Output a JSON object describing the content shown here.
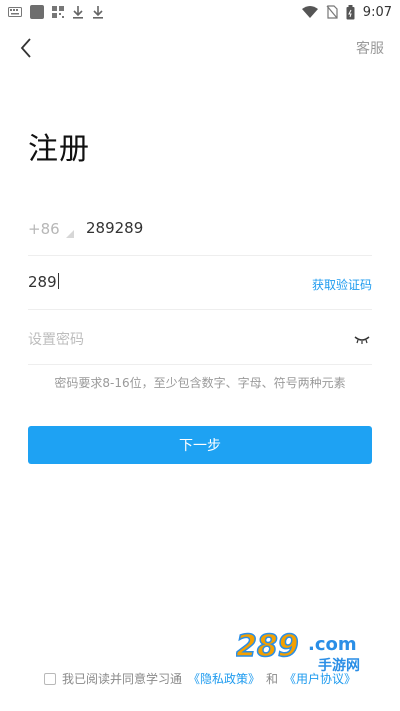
{
  "status_bar": {
    "time": "9:07",
    "icons": [
      "keyboard-icon",
      "square-icon",
      "qr-icon",
      "download-icon",
      "download-icon",
      "wifi-icon",
      "no-sim-icon",
      "battery-icon"
    ]
  },
  "header": {
    "back_icon": "chevron-left-icon",
    "service_label": "客服"
  },
  "page": {
    "title": "注册"
  },
  "form": {
    "country_code": "+86",
    "phone": "289289",
    "code_value": "289",
    "get_code_label": "获取验证码",
    "password_placeholder": "设置密码",
    "password_hint": "密码要求8-16位，至少包含数字、字母、符号两种元素",
    "next_label": "下一步"
  },
  "agreement": {
    "text": "我已阅读并同意学习通",
    "privacy_link": "《隐私政策》",
    "and": "和",
    "user_link": "《用户协议》"
  },
  "watermark": {
    "brand": "289.com",
    "sub": "手游网"
  },
  "colors": {
    "accent": "#1ea2f3",
    "link": "#1e9bef",
    "muted": "#9a9a9a",
    "watermark_orange": "#f4a000",
    "watermark_blue": "#2a8ee6"
  }
}
